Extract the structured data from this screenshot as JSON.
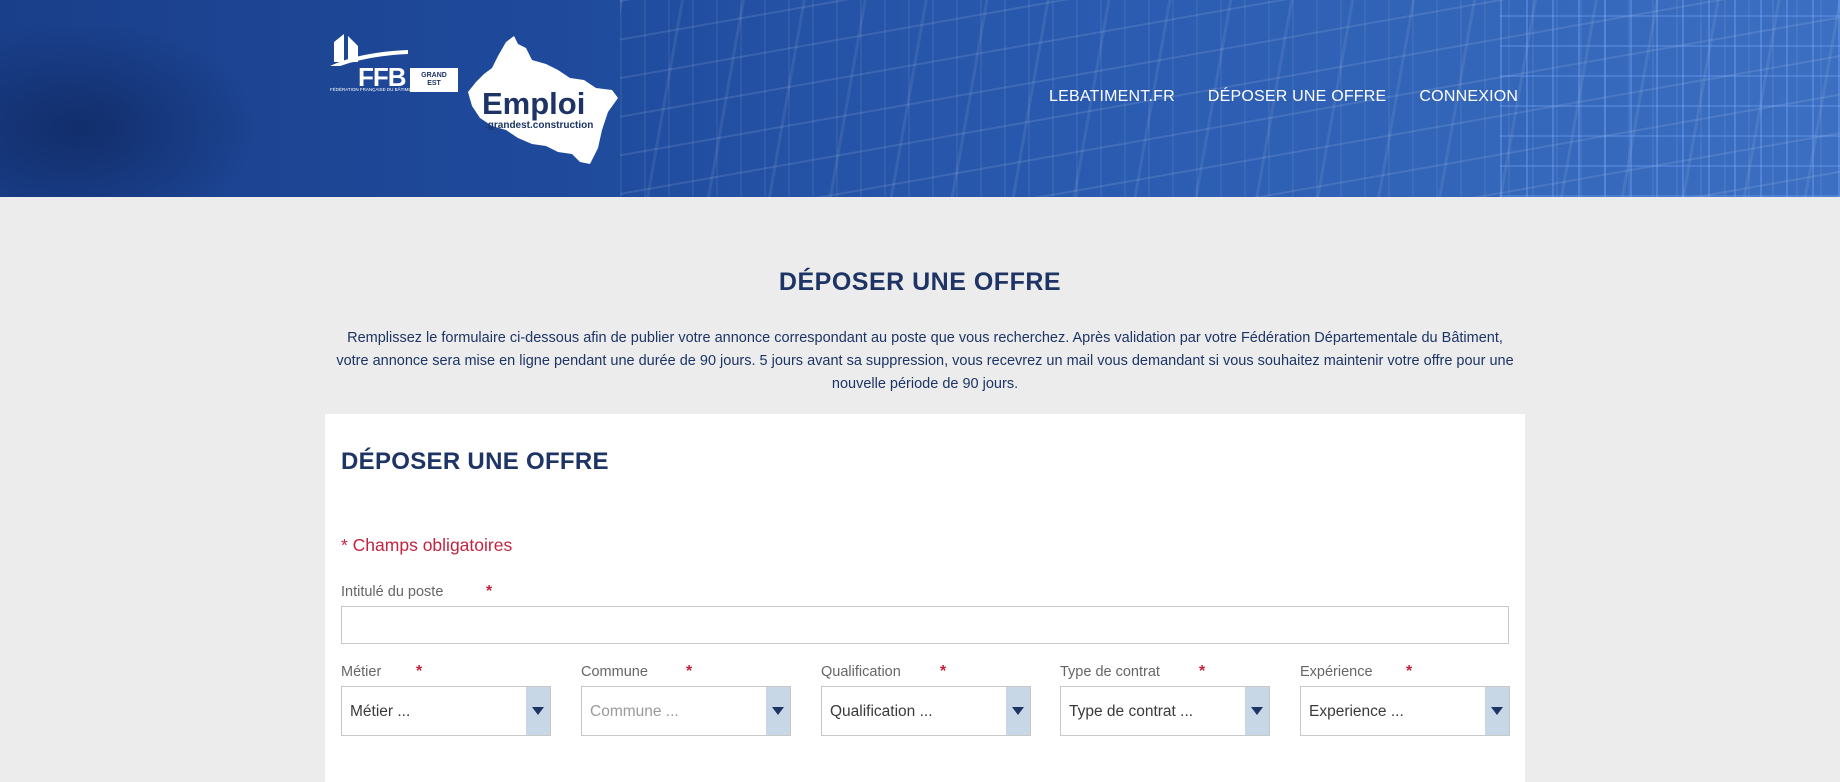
{
  "header": {
    "logo_ffb": "FFB",
    "logo_ffb_small": "FÉDÉRATION FRANÇAISE DU BÂTIMENT",
    "grand_est_line1": "GRAND",
    "grand_est_line2": "EST",
    "emploi_title": "Emploi",
    "emploi_sub": ".grandest.construction",
    "nav": [
      {
        "label": "LEBATIMENT.FR"
      },
      {
        "label": "DÉPOSER UNE OFFRE"
      },
      {
        "label": "CONNEXION"
      }
    ]
  },
  "main": {
    "title": "DÉPOSER UNE OFFRE",
    "intro": "Remplissez le formulaire ci-dessous afin de publier votre annonce correspondant au poste que vous recherchez. Après validation par votre Fédération Départementale du Bâtiment, votre annonce sera mise en ligne pendant une durée de 90 jours. 5 jours avant sa suppression, vous recevrez un mail vous demandant si vous souhaitez maintenir votre offre pour une nouvelle période de 90 jours."
  },
  "form": {
    "title": "DÉPOSER UNE OFFRE",
    "required_note": "* Champs obligatoires",
    "star": "*",
    "intitule_label": "Intitulé du poste",
    "intitule_value": "",
    "selects": [
      {
        "label": "Métier",
        "value": "Métier ..."
      },
      {
        "label": "Commune",
        "value": "Commune ..."
      },
      {
        "label": "Qualification",
        "value": "Qualification ..."
      },
      {
        "label": "Type de contrat",
        "value": "Type de contrat ..."
      },
      {
        "label": "Expérience",
        "value": "Experience ..."
      }
    ]
  },
  "colors": {
    "primary": "#1d3465",
    "required": "#c3233f",
    "header_blue": "#1f4a9c",
    "select_arrow_bg": "#c8d7e6"
  }
}
